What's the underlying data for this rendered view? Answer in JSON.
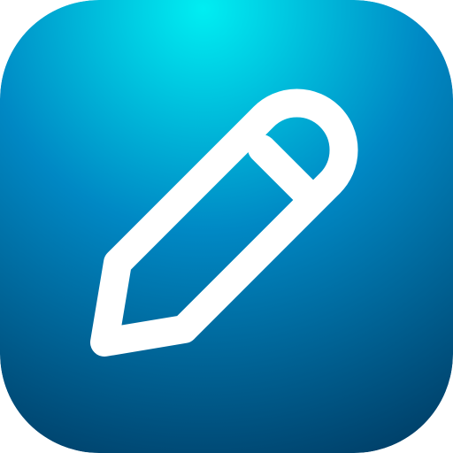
{
  "icon": {
    "name": "pencil-icon",
    "colors": {
      "gradient_start": "#00EEF2",
      "gradient_mid": "#0088C4",
      "gradient_end": "#003C64",
      "stroke": "#FFFFFF"
    }
  }
}
